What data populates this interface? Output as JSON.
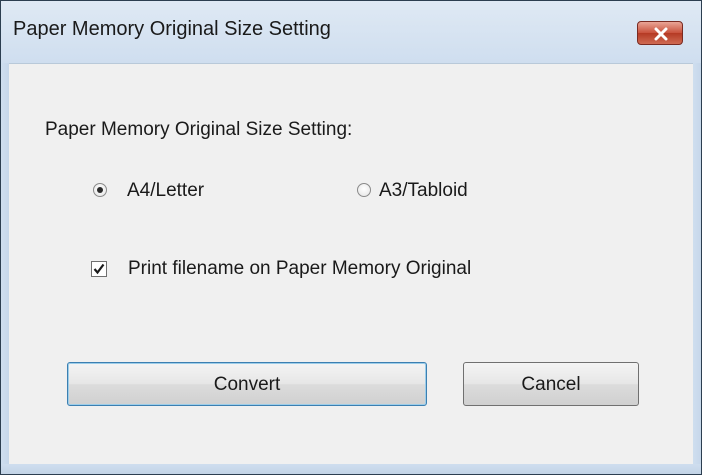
{
  "dialog": {
    "title": "Paper Memory Original Size Setting",
    "close_icon": "close-icon"
  },
  "size_group": {
    "label": "Paper Memory Original Size Setting:",
    "options": [
      {
        "label": "A4/Letter",
        "selected": true
      },
      {
        "label": "A3/Tabloid",
        "selected": false
      }
    ]
  },
  "print_filename": {
    "label": "Print filename on Paper Memory Original",
    "checked": true
  },
  "buttons": {
    "convert": "Convert",
    "cancel": "Cancel"
  },
  "colors": {
    "titlebar": "#cfdeef",
    "close_button": "#c9513c",
    "dialog_background": "#f0f0f0"
  }
}
